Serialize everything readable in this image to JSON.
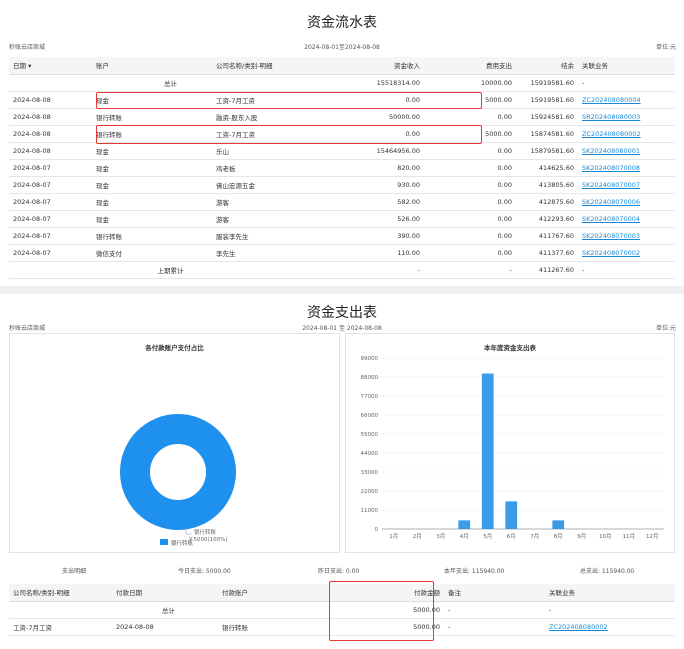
{
  "flow": {
    "title": "资金流水表",
    "store": "秒账云店商城",
    "date_range": "2024-08-01至2024-08-08",
    "unit": "单位:元",
    "headers": [
      "日期 ▾",
      "账户",
      "公司名称/类别-明细",
      "资金收入",
      "费用支出",
      "结余",
      "关联业务"
    ],
    "total_row": {
      "label": "总计",
      "income": "15518314.00",
      "expense": "10000.00",
      "balance": "15919581.60",
      "link": "-"
    },
    "rows": [
      {
        "date": "2024-08-08",
        "account": "现金",
        "company": "工资-7月工资",
        "income": "0.00",
        "expense": "5000.00",
        "balance": "15919581.60",
        "link": "ZC202408080004"
      },
      {
        "date": "2024-08-08",
        "account": "银行转账",
        "company": "融资-股东入股",
        "income": "50000.00",
        "expense": "0.00",
        "balance": "15924581.60",
        "link": "SR202408080003"
      },
      {
        "date": "2024-08-08",
        "account": "银行转账",
        "company": "工资-7月工资",
        "income": "0.00",
        "expense": "5000.00",
        "balance": "15874581.60",
        "link": "ZC202408080002"
      },
      {
        "date": "2024-08-08",
        "account": "现金",
        "company": "乐山",
        "income": "15464956.00",
        "expense": "0.00",
        "balance": "15879581.60",
        "link": "SK202408080001"
      },
      {
        "date": "2024-08-07",
        "account": "现金",
        "company": "鸡老板",
        "income": "820.00",
        "expense": "0.00",
        "balance": "414625.60",
        "link": "SK202408070008"
      },
      {
        "date": "2024-08-07",
        "account": "现金",
        "company": "佛山宏源五金",
        "income": "930.00",
        "expense": "0.00",
        "balance": "413805.60",
        "link": "SK202408070007"
      },
      {
        "date": "2024-08-07",
        "account": "现金",
        "company": "游客",
        "income": "582.00",
        "expense": "0.00",
        "balance": "412875.60",
        "link": "SK202408070006"
      },
      {
        "date": "2024-08-07",
        "account": "现金",
        "company": "游客",
        "income": "526.00",
        "expense": "0.00",
        "balance": "412293.60",
        "link": "SK202408070004"
      },
      {
        "date": "2024-08-07",
        "account": "银行转账",
        "company": "服装李先生",
        "income": "390.00",
        "expense": "0.00",
        "balance": "411767.60",
        "link": "SK202408070003"
      },
      {
        "date": "2024-08-07",
        "account": "微信支付",
        "company": "李先生",
        "income": "110.00",
        "expense": "0.00",
        "balance": "411377.60",
        "link": "SK202408070002"
      }
    ],
    "prev_row": {
      "label": "上期累计",
      "income": "-",
      "expense": "-",
      "balance": "411267.60",
      "link": "-"
    }
  },
  "expense": {
    "title": "资金支出表",
    "store": "秒账云店商城",
    "date_range": "2024-08-01 至 2024-08-08",
    "unit": "单位:元",
    "donut_title": "各付款账户支付占比",
    "donut_label_line1": "银行转账",
    "donut_label_line2": "￥5000(100%)",
    "donut_legend": "银行转账",
    "bar_title": "本年度资金支出表",
    "summary": {
      "label": "支出明细",
      "today": "今日支出: 5000.00",
      "yesterday": "昨日支出: 0.00",
      "year": "本年支出: 115940.00",
      "total": "总支出: 115940.00"
    },
    "headers": [
      "公司名称/类别-明细",
      "付款日期",
      "付款账户",
      "付款金额",
      "备注",
      "关联业务"
    ],
    "total_row": {
      "label": "总计",
      "amount": "5000.00",
      "note": "-",
      "link": "-"
    },
    "rows": [
      {
        "company": "工资-7月工资",
        "date": "2024-08-08",
        "account": "银行转账",
        "amount": "5000.00",
        "note": "-",
        "link": "ZC202408080002"
      }
    ]
  },
  "chart_data": [
    {
      "type": "pie",
      "title": "各付款账户支付占比",
      "categories": [
        "银行转账"
      ],
      "values": [
        5000
      ],
      "colors": [
        "#1e90ee"
      ]
    },
    {
      "type": "bar",
      "title": "本年度资金支出表",
      "categories": [
        "1月",
        "2月",
        "3月",
        "4月",
        "5月",
        "6月",
        "7月",
        "8月",
        "9月",
        "10月",
        "11月",
        "12月"
      ],
      "values": [
        0,
        0,
        0,
        5000,
        90000,
        16000,
        0,
        5000,
        0,
        0,
        0,
        0
      ],
      "ylim": [
        0,
        99000
      ],
      "yticks": [
        0,
        11000,
        22000,
        33000,
        44000,
        55000,
        66000,
        77000,
        88000,
        99000
      ],
      "color": "#3a9be8"
    }
  ]
}
